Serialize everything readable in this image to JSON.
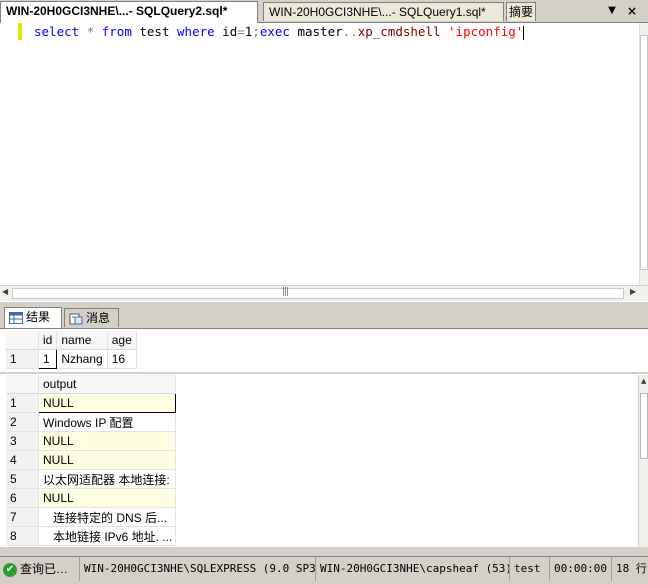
{
  "tabs": [
    {
      "label": "WIN-20H0GCI3NHE\\...- SQLQuery2.sql*",
      "active": true
    },
    {
      "label": "WIN-20H0GCI3NHE\\...- SQLQuery1.sql*",
      "active": false
    },
    {
      "label": "摘要",
      "active": false
    }
  ],
  "tab_controls": {
    "dropdown": "▼",
    "close": "×"
  },
  "editor": {
    "tokens": {
      "t1": "select",
      "t2": " ",
      "t3": "*",
      "t4": " ",
      "t5": "from",
      "t6": " test ",
      "t7": "where",
      "t8": " id",
      "t9": "=",
      "t10": "1",
      "t11": ";",
      "t12": "exec",
      "t13": " master",
      "t14": "..",
      "t15": "xp_cmdshell",
      "t16": " ",
      "t17": "'ipconfig'"
    }
  },
  "scroll": {
    "grip": "|||",
    "left": "◀",
    "right": "▶",
    "up": "▲"
  },
  "result_tabs": {
    "results": "结果",
    "messages": "消息"
  },
  "grid1": {
    "columns": [
      "id",
      "name",
      "age"
    ],
    "rows": [
      {
        "num": "1",
        "id": "1",
        "name": "Nzhang",
        "age": "16"
      }
    ]
  },
  "grid2": {
    "column": "output",
    "rows": [
      {
        "num": "1",
        "value": "NULL"
      },
      {
        "num": "2",
        "value": "Windows IP 配置"
      },
      {
        "num": "3",
        "value": "NULL"
      },
      {
        "num": "4",
        "value": "NULL"
      },
      {
        "num": "5",
        "value": "以太网适配器 本地连接:"
      },
      {
        "num": "6",
        "value": "NULL"
      },
      {
        "num": "7",
        "value": "   连接特定的 DNS 后..."
      },
      {
        "num": "8",
        "value": "   本地链接 IPv6 地址. ..."
      }
    ]
  },
  "status": {
    "state": "查询已…",
    "server": "WIN-20H0GCI3NHE\\SQLEXPRESS (9.0 SP3)",
    "user": "WIN-20H0GCI3NHE\\capsheaf (53)",
    "database": "test",
    "elapsed": "00:00:00",
    "rows": "18 行"
  },
  "colors": {
    "keyword": "#0000ff",
    "operator": "#808080",
    "system_proc": "#800000",
    "string": "#ff0000",
    "null_highlight": "#ffffe1",
    "status_ok": "#2f9e2f"
  }
}
